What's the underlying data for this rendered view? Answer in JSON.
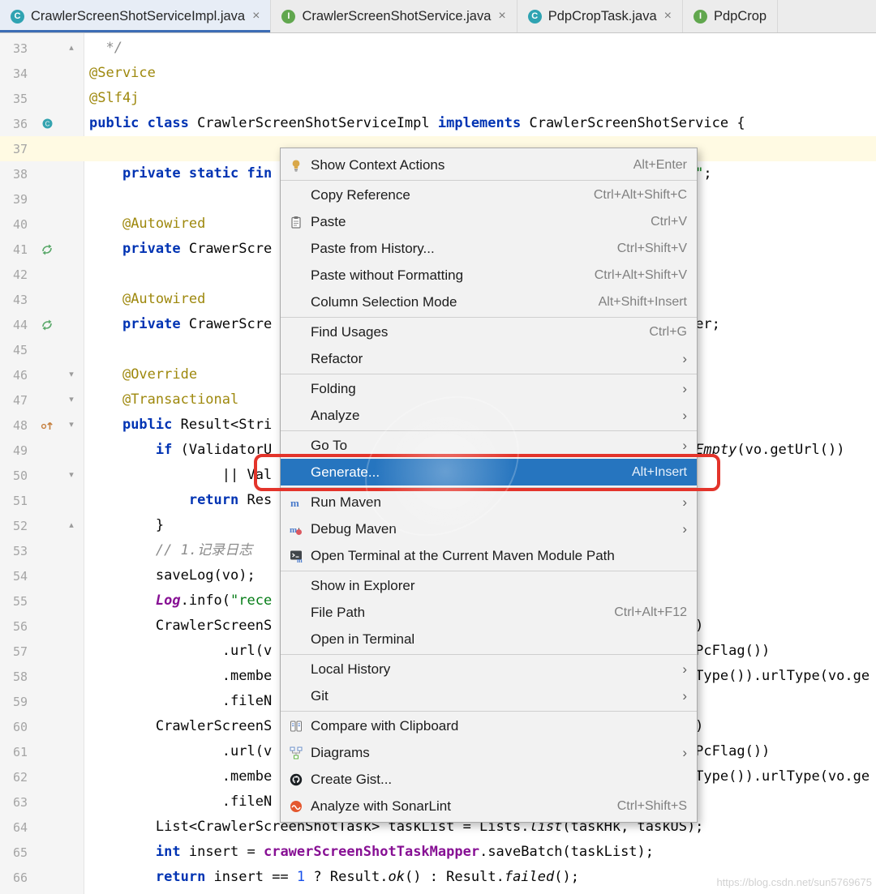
{
  "ui": {
    "close_glyph": "×",
    "class_letter": "C",
    "interface_letter": "I",
    "submenu_arrow": "›"
  },
  "colors": {
    "selection_blue": "#2675BF",
    "annotation_red": "#E3342B",
    "active_tab_underline": "#3D6DB5",
    "keyword": "#0033B3",
    "string": "#067D17",
    "annotation": "#9E880D",
    "comment": "#8C8C8C",
    "field_purple": "#871094",
    "current_line": "#FFFAE3"
  },
  "tabs": [
    {
      "label": "CrawlerScreenShotServiceImpl.java",
      "icon": "class",
      "active": true
    },
    {
      "label": "CrawlerScreenShotService.java",
      "icon": "interface",
      "active": false
    },
    {
      "label": "PdpCropTask.java",
      "icon": "class",
      "active": false
    },
    {
      "label": "PdpCrop",
      "icon": "interface",
      "active": false
    }
  ],
  "menu": {
    "items": [
      {
        "label": "Show Context Actions",
        "shortcut": "Alt+Enter",
        "icon": "context-actions"
      },
      {
        "sep": true
      },
      {
        "label": "Copy Reference",
        "shortcut": "Ctrl+Alt+Shift+C"
      },
      {
        "label": "Paste",
        "shortcut": "Ctrl+V",
        "icon": "paste"
      },
      {
        "label": "Paste from History...",
        "shortcut": "Ctrl+Shift+V"
      },
      {
        "label": "Paste without Formatting",
        "shortcut": "Ctrl+Alt+Shift+V"
      },
      {
        "label": "Column Selection Mode",
        "shortcut": "Alt+Shift+Insert"
      },
      {
        "sep": true
      },
      {
        "label": "Find Usages",
        "shortcut": "Ctrl+G"
      },
      {
        "label": "Refactor",
        "submenu": true
      },
      {
        "sep": true
      },
      {
        "label": "Folding",
        "submenu": true
      },
      {
        "label": "Analyze",
        "submenu": true
      },
      {
        "sep": true
      },
      {
        "label": "Go To",
        "submenu": true
      },
      {
        "label": "Generate...",
        "shortcut": "Alt+Insert",
        "selected": true
      },
      {
        "sep": true
      },
      {
        "label": "Run Maven",
        "submenu": true,
        "icon": "maven"
      },
      {
        "label": "Debug Maven",
        "submenu": true,
        "icon": "maven-debug"
      },
      {
        "label": "Open Terminal at the Current Maven Module Path",
        "icon": "maven-terminal"
      },
      {
        "sep": true
      },
      {
        "label": "Show in Explorer"
      },
      {
        "label": "File Path",
        "shortcut": "Ctrl+Alt+F12"
      },
      {
        "label": "Open in Terminal"
      },
      {
        "sep": true
      },
      {
        "label": "Local History",
        "submenu": true
      },
      {
        "label": "Git",
        "submenu": true
      },
      {
        "sep": true
      },
      {
        "label": "Compare with Clipboard",
        "icon": "compare"
      },
      {
        "label": "Diagrams",
        "submenu": true,
        "icon": "diagrams"
      },
      {
        "label": "Create Gist...",
        "icon": "github"
      },
      {
        "label": "Analyze with SonarLint",
        "shortcut": "Ctrl+Shift+S",
        "icon": "sonarlint"
      }
    ]
  },
  "editor": {
    "lines": [
      {
        "n": 33,
        "fold": "up",
        "tokens": [
          {
            "t": "  */",
            "s": "com"
          }
        ]
      },
      {
        "n": 34,
        "tokens": [
          {
            "t": "@Service",
            "s": "ann"
          }
        ]
      },
      {
        "n": 35,
        "tokens": [
          {
            "t": "@Slf4j",
            "s": "ann"
          }
        ]
      },
      {
        "n": 36,
        "icon": "class",
        "tokens": [
          {
            "t": "public class ",
            "s": "kw"
          },
          {
            "t": "CrawlerScreenShotServiceImpl ",
            "s": "plain"
          },
          {
            "t": "implements ",
            "s": "kw"
          },
          {
            "t": "CrawlerScreenShotService {",
            "s": "plain"
          }
        ]
      },
      {
        "n": 37,
        "current": true,
        "tokens": []
      },
      {
        "n": 38,
        "tokens": [
          {
            "pad": 4
          },
          {
            "t": "private static fin",
            "s": "kw"
          },
          {
            "pad": 51
          },
          {
            "t": "\"",
            "s": "str"
          },
          {
            "t": ";",
            "s": "plain"
          }
        ]
      },
      {
        "n": 39,
        "tokens": []
      },
      {
        "n": 40,
        "tokens": [
          {
            "pad": 4
          },
          {
            "t": "@Autowired",
            "s": "ann"
          }
        ]
      },
      {
        "n": 41,
        "icon": "spring",
        "tokens": [
          {
            "pad": 4
          },
          {
            "t": "private",
            "s": "kw"
          },
          {
            "t": " CrawerScre",
            "s": "plain"
          }
        ]
      },
      {
        "n": 42,
        "tokens": []
      },
      {
        "n": 43,
        "tokens": [
          {
            "pad": 4
          },
          {
            "t": "@Autowired",
            "s": "ann"
          }
        ]
      },
      {
        "n": 44,
        "icon": "spring",
        "tokens": [
          {
            "pad": 4
          },
          {
            "t": "private",
            "s": "kw"
          },
          {
            "t": " CrawerScre",
            "s": "plain"
          },
          {
            "pad": 51
          },
          {
            "t": "er;",
            "s": "plain"
          }
        ]
      },
      {
        "n": 45,
        "tokens": []
      },
      {
        "n": 46,
        "fold": "down",
        "tokens": [
          {
            "pad": 4
          },
          {
            "t": "@Override",
            "s": "ann"
          }
        ]
      },
      {
        "n": 47,
        "fold": "down",
        "tokens": [
          {
            "pad": 4
          },
          {
            "t": "@Transactional",
            "s": "ann"
          }
        ]
      },
      {
        "n": 48,
        "icon": "override",
        "fold": "down",
        "tokens": [
          {
            "pad": 4
          },
          {
            "t": "public ",
            "s": "kw"
          },
          {
            "t": "Result<Stri",
            "s": "plain"
          }
        ]
      },
      {
        "n": 49,
        "tokens": [
          {
            "pad": 8
          },
          {
            "t": "if",
            "s": "kw"
          },
          {
            "t": " (ValidatorU",
            "s": "plain"
          },
          {
            "pad": 51
          },
          {
            "t": "Empty",
            "s": "sm"
          },
          {
            "t": "(vo.getUrl())",
            "s": "plain"
          }
        ]
      },
      {
        "n": 50,
        "fold": "down",
        "tokens": [
          {
            "pad": 16
          },
          {
            "t": "|| Val",
            "s": "plain"
          }
        ]
      },
      {
        "n": 51,
        "tokens": [
          {
            "pad": 12
          },
          {
            "t": "return",
            "s": "kw"
          },
          {
            "t": " Res",
            "s": "plain"
          }
        ]
      },
      {
        "n": 52,
        "fold": "up",
        "tokens": [
          {
            "pad": 8
          },
          {
            "t": "}",
            "s": "plain"
          }
        ]
      },
      {
        "n": 53,
        "tokens": [
          {
            "pad": 8
          },
          {
            "t": "// 1.记录日志",
            "s": "com"
          }
        ]
      },
      {
        "n": 54,
        "tokens": [
          {
            "pad": 8
          },
          {
            "t": "saveLog(vo);",
            "s": "plain"
          }
        ]
      },
      {
        "n": 55,
        "tokens": [
          {
            "pad": 8
          },
          {
            "t": "Log",
            "s": "sfield"
          },
          {
            "t": ".info(",
            "s": "plain"
          },
          {
            "t": "\"rece",
            "s": "str"
          }
        ]
      },
      {
        "n": 56,
        "tokens": [
          {
            "pad": 8
          },
          {
            "t": "CrawlerScreenS",
            "s": "plain"
          },
          {
            "pad": 51
          },
          {
            "t": ")",
            "s": "plain"
          }
        ]
      },
      {
        "n": 57,
        "tokens": [
          {
            "pad": 16
          },
          {
            "t": ".url(v",
            "s": "plain"
          },
          {
            "pad": 46
          },
          {
            "t": "o.getPcFlag())",
            "s": "plain"
          }
        ]
      },
      {
        "n": 58,
        "tokens": [
          {
            "pad": 16
          },
          {
            "t": ".membe",
            "s": "plain"
          },
          {
            "pad": 51
          },
          {
            "t": "Type()).urlType(vo.ge",
            "s": "plain"
          }
        ]
      },
      {
        "n": 59,
        "tokens": [
          {
            "pad": 16
          },
          {
            "t": ".fileN",
            "s": "plain"
          }
        ]
      },
      {
        "n": 60,
        "tokens": [
          {
            "pad": 8
          },
          {
            "t": "CrawlerScreenS",
            "s": "plain"
          },
          {
            "pad": 51
          },
          {
            "t": ")",
            "s": "plain"
          }
        ]
      },
      {
        "n": 61,
        "tokens": [
          {
            "pad": 16
          },
          {
            "t": ".url(v",
            "s": "plain"
          },
          {
            "pad": 46
          },
          {
            "t": "o.getPcFlag())",
            "s": "plain"
          }
        ]
      },
      {
        "n": 62,
        "tokens": [
          {
            "pad": 16
          },
          {
            "t": ".membe",
            "s": "plain"
          },
          {
            "pad": 51
          },
          {
            "t": "Type()).urlType(vo.ge",
            "s": "plain"
          }
        ]
      },
      {
        "n": 63,
        "tokens": [
          {
            "pad": 16
          },
          {
            "t": ".fileN",
            "s": "plain"
          }
        ]
      },
      {
        "n": 64,
        "tokens": [
          {
            "pad": 8
          },
          {
            "t": "List<CrawlerScreenShotTask> taskList = Lists.",
            "s": "plain"
          },
          {
            "t": "list",
            "s": "sm"
          },
          {
            "t": "(taskHk, taskUS);",
            "s": "plain"
          }
        ]
      },
      {
        "n": 65,
        "tokens": [
          {
            "pad": 8
          },
          {
            "t": "int",
            "s": "kw"
          },
          {
            "t": " insert = ",
            "s": "plain"
          },
          {
            "t": "crawerScreenShotTaskMapper",
            "s": "field"
          },
          {
            "t": ".saveBatch(taskList);",
            "s": "plain"
          }
        ]
      },
      {
        "n": 66,
        "tokens": [
          {
            "pad": 8
          },
          {
            "t": "return",
            "s": "kw"
          },
          {
            "t": " insert == ",
            "s": "plain"
          },
          {
            "t": "1",
            "s": "num"
          },
          {
            "t": " ? Result.",
            "s": "plain"
          },
          {
            "t": "ok",
            "s": "sm"
          },
          {
            "t": "() : Result.",
            "s": "plain"
          },
          {
            "t": "failed",
            "s": "sm"
          },
          {
            "t": "();",
            "s": "plain"
          }
        ]
      }
    ]
  },
  "watermark": {
    "url": "https://blog.csdn.net/sun5769675"
  }
}
